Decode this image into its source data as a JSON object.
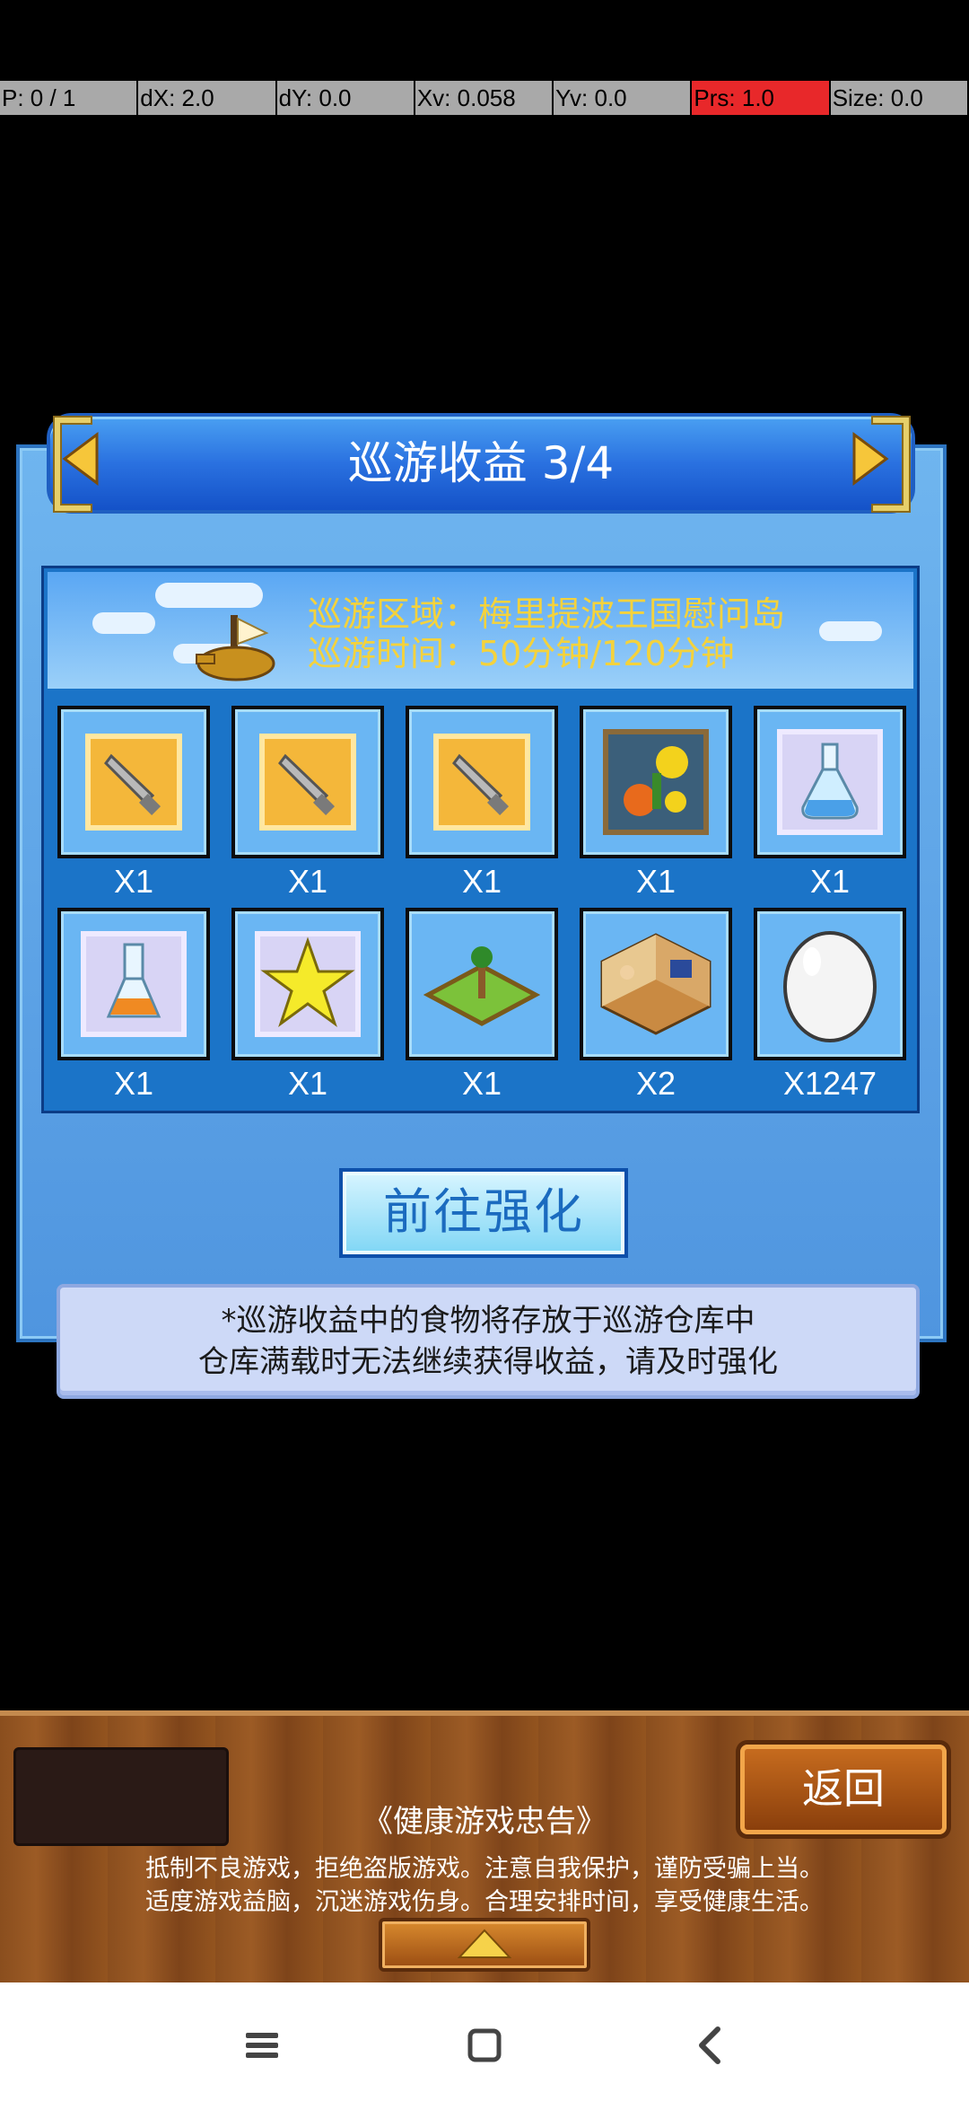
{
  "debug": {
    "p": "P: 0 / 1",
    "dx": "dX: 2.0",
    "dy": "dY: 0.0",
    "xv": "Xv: 0.058",
    "yv": "Yv: 0.0",
    "prs": "Prs: 1.0",
    "size": "Size: 0.0"
  },
  "dialog": {
    "title": "巡游收益 3/4",
    "region_line": "巡游区域：梅里提波王国慰问岛",
    "time_line": "巡游时间：50分钟/120分钟",
    "items": [
      {
        "icon": "dagger-icon",
        "qty": "X1"
      },
      {
        "icon": "dagger-icon",
        "qty": "X1"
      },
      {
        "icon": "dagger-icon",
        "qty": "X1"
      },
      {
        "icon": "flower-bouquet-icon",
        "qty": "X1"
      },
      {
        "icon": "blue-potion-icon",
        "qty": "X1"
      },
      {
        "icon": "orange-potion-icon",
        "qty": "X1"
      },
      {
        "icon": "star-icon",
        "qty": "X1"
      },
      {
        "icon": "palm-plot-icon",
        "qty": "X1"
      },
      {
        "icon": "room-icon",
        "qty": "X2"
      },
      {
        "icon": "egg-icon",
        "qty": "X1247"
      }
    ],
    "go_button": "前往强化",
    "notice_line1": "*巡游收益中的食物将存放于巡游仓库中",
    "notice_line2": "仓库满载时无法继续获得收益，请及时强化"
  },
  "footer": {
    "back_button": "返回",
    "title": "《健康游戏忠告》",
    "line1": "抵制不良游戏，拒绝盗版游戏。注意自我保护，谨防受骗上当。",
    "line2": "适度游戏益脑，沉迷游戏伤身。合理安排时间，享受健康生活。"
  },
  "colors": {
    "accent_blue": "#2a71e0",
    "info_text": "#f4d23c",
    "debug_red": "#e8282a"
  }
}
